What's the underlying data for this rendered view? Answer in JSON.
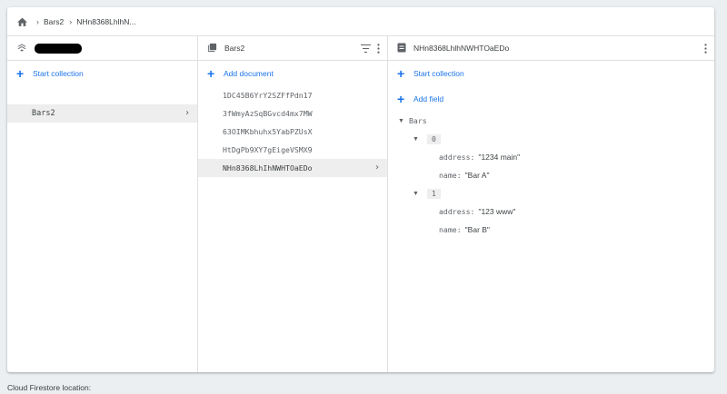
{
  "breadcrumb": {
    "home_icon": "home-icon",
    "items": [
      "Bars2",
      "NHn8368LhlhN..."
    ]
  },
  "root_panel": {
    "icon": "firestore-icon",
    "start_collection_label": "Start collection",
    "collections": [
      {
        "label": "Bars2"
      }
    ]
  },
  "collection_panel": {
    "title": "Bars2",
    "add_document_label": "Add document",
    "documents": [
      "1DC45B6YrY2SZFfPdn17",
      "3fWmyAzSqBGvcd4mx7MW",
      "63OIMKbhuhx5YabPZUsX",
      "HtDgPb9XY7gEigeVSMX9",
      "NHn8368LhIhNWHTOaEDo"
    ],
    "selected_index": 4
  },
  "document_panel": {
    "title": "NHn8368LhlhNWHTOaEDo",
    "start_collection_label": "Start collection",
    "add_field_label": "Add field",
    "field_name": "Bars",
    "items": [
      {
        "index": "0",
        "address_key": "address:",
        "address_value": "\"1234 main\"",
        "name_key": "name:",
        "name_value": "\"Bar A\""
      },
      {
        "index": "1",
        "address_key": "address:",
        "address_value": "\"123 www\"",
        "name_key": "name:",
        "name_value": "\"Bar B\""
      }
    ]
  },
  "footer": {
    "label": "Cloud Firestore location:"
  },
  "colors": {
    "accent": "#1a73e8",
    "selected_bg": "#eeeeee",
    "background": "#eceff1"
  }
}
